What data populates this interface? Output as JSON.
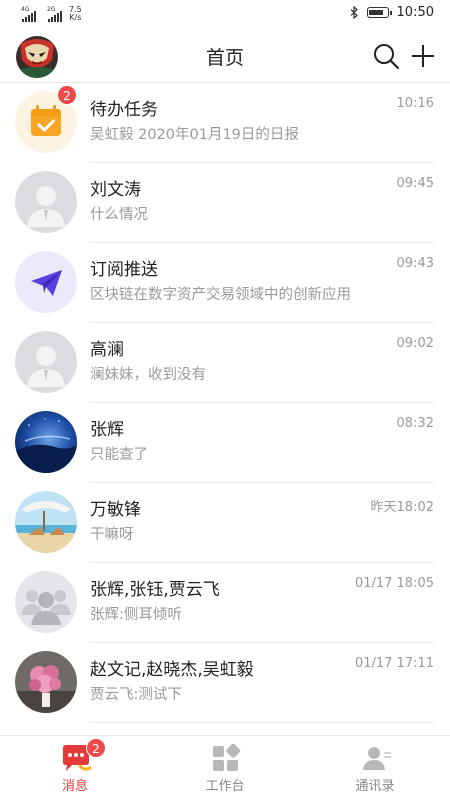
{
  "status_bar": {
    "signal1_tag": "4G",
    "signal2_tag": "2G",
    "speed_value": "7.5",
    "speed_unit": "K/s",
    "time": "10:50",
    "battery_level": 0.85
  },
  "header": {
    "title": "首页"
  },
  "conversations": [
    {
      "name": "待办任务",
      "time": "10:16",
      "preview": "吴虹毅 2020年01月19日的日报",
      "badge": "2",
      "icon": "calendar-check-icon"
    },
    {
      "name": "刘文涛",
      "time": "09:45",
      "preview": "什么情况",
      "icon": "default-person-avatar"
    },
    {
      "name": "订阅推送",
      "time": "09:43",
      "preview": "区块链在数字资产交易领域中的创新应用",
      "icon": "paper-plane-icon"
    },
    {
      "name": "高澜",
      "time": "09:02",
      "preview": "澜妹妹，收到没有",
      "icon": "default-person-avatar"
    },
    {
      "name": "张辉",
      "time": "08:32",
      "preview": "只能查了",
      "icon": "photo-avatar-night-sky"
    },
    {
      "name": "万敏锋",
      "time": "昨天18:02",
      "preview": "干嘛呀",
      "icon": "photo-avatar-beach"
    },
    {
      "name": "张辉,张钰,贾云飞",
      "time": "01/17 18:05",
      "preview": "张辉:侧耳倾听",
      "icon": "group-avatar"
    },
    {
      "name": "赵文记,赵晓杰,吴虹毅",
      "time": "01/17 17:11",
      "preview": "贾云飞:测试下",
      "icon": "photo-avatar-flowers"
    }
  ],
  "tabs": [
    {
      "label": "消息",
      "badge": "2",
      "active": true,
      "icon": "chat-bubble-icon"
    },
    {
      "label": "工作台",
      "active": false,
      "icon": "workbench-grid-icon"
    },
    {
      "label": "通讯录",
      "active": false,
      "icon": "contacts-icon"
    }
  ],
  "colors": {
    "accent": "#e23a3a",
    "badge": "#ee4a4a",
    "calendar": "#f6a623",
    "subscribe": "#5a3fe0",
    "muted_text": "#9a9a9a"
  }
}
